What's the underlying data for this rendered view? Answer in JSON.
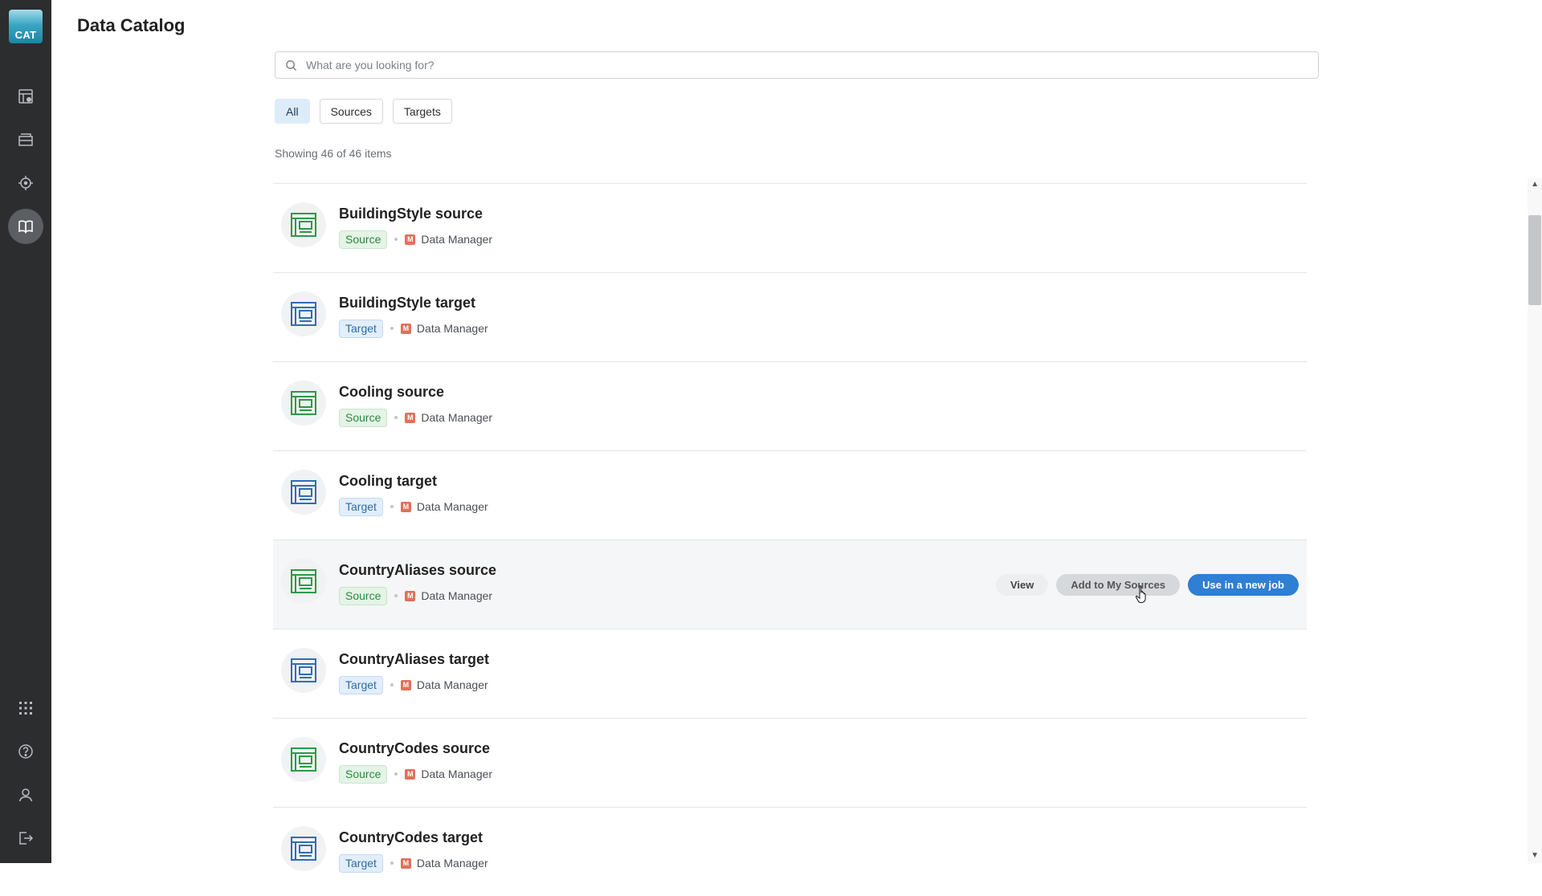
{
  "sidebar": {
    "logo_text": "CAT",
    "nav_icons": [
      "jobs-icon",
      "folder-icon",
      "target-icon",
      "catalog-book-icon"
    ],
    "active_nav": "catalog-book-icon",
    "bottom_icons": [
      "apps-grid-icon",
      "help-icon",
      "user-icon",
      "logout-icon"
    ]
  },
  "header": {
    "title": "Data Catalog"
  },
  "search": {
    "placeholder": "What are you looking for?"
  },
  "filters": [
    {
      "label": "All",
      "active": true
    },
    {
      "label": "Sources",
      "active": false
    },
    {
      "label": "Targets",
      "active": false
    }
  ],
  "count_text": "Showing 46 of 46 items",
  "items": [
    {
      "name": "BuildingStyle source",
      "type": "Source",
      "owner": "Data Manager",
      "owner_initial": "M"
    },
    {
      "name": "BuildingStyle target",
      "type": "Target",
      "owner": "Data Manager",
      "owner_initial": "M"
    },
    {
      "name": "Cooling source",
      "type": "Source",
      "owner": "Data Manager",
      "owner_initial": "M"
    },
    {
      "name": "Cooling target",
      "type": "Target",
      "owner": "Data Manager",
      "owner_initial": "M"
    },
    {
      "name": "CountryAliases source",
      "type": "Source",
      "owner": "Data Manager",
      "owner_initial": "M"
    },
    {
      "name": "CountryAliases target",
      "type": "Target",
      "owner": "Data Manager",
      "owner_initial": "M"
    },
    {
      "name": "CountryCodes source",
      "type": "Source",
      "owner": "Data Manager",
      "owner_initial": "M"
    },
    {
      "name": "CountryCodes target",
      "type": "Target",
      "owner": "Data Manager",
      "owner_initial": "M"
    }
  ],
  "hover_actions": {
    "view_label": "View",
    "add_label": "Add to My Sources",
    "use_label": "Use in a new job"
  },
  "colors": {
    "sidebar_bg": "#2b2d2f",
    "source_icon": "#2b9a48",
    "target_icon": "#2e6db8",
    "primary_button": "#2f7fd4",
    "owner_badge": "#e1705b"
  }
}
